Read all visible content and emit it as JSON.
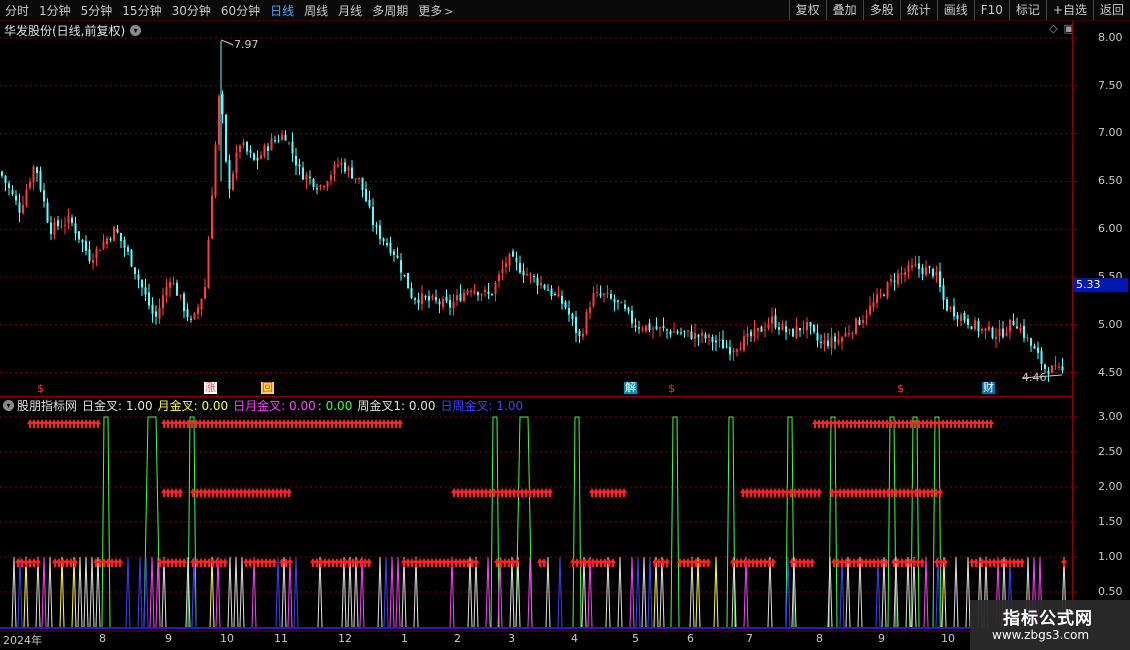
{
  "toolbar": {
    "periods": [
      "分时",
      "1分钟",
      "5分钟",
      "15分钟",
      "30分钟",
      "60分钟",
      "日线",
      "周线",
      "月线",
      "多周期",
      "更多"
    ],
    "active_period": "日线",
    "tools": [
      "复权",
      "叠加",
      "多股",
      "统计",
      "画线",
      "F10",
      "标记",
      "+自选",
      "返回"
    ]
  },
  "title": {
    "stock": "华发股份(日线,前复权)"
  },
  "price_axis": {
    "labels": [
      "8.00",
      "7.50",
      "7.00",
      "6.50",
      "6.00",
      "5.50",
      "5.00",
      "4.50"
    ],
    "current": "5.33"
  },
  "annotations": {
    "high": "7.97",
    "low": "4.46"
  },
  "signals": [
    {
      "text": "$",
      "color": "#ff3030"
    },
    {
      "text": "涨",
      "color": "#ff4040"
    },
    {
      "text": "回",
      "color": "#ffd060"
    },
    {
      "text": "解",
      "color": "#40c8ff"
    },
    {
      "text": "$",
      "color": "#ff3030"
    },
    {
      "text": "$",
      "color": "#ff3030"
    },
    {
      "text": "财",
      "color": "#40c8ff"
    }
  ],
  "indicator": {
    "name": "股朋指标网",
    "items": [
      {
        "label": "日金叉: 1.00",
        "color": "#e0e0e0"
      },
      {
        "label": "月金叉: 0.00",
        "color": "#ffff40"
      },
      {
        "label": "日月金叉: 0.00",
        "color": "#ff40ff"
      },
      {
        "label": ": 0.00",
        "color": "#40ff40"
      },
      {
        "label": "周金叉1: 0.00",
        "color": "#e0e0e0"
      },
      {
        "label": "日周金叉: 1.00",
        "color": "#4040ff"
      }
    ],
    "axis": [
      "3.00",
      "2.50",
      "2.00",
      "1.50",
      "1.00",
      "0.50"
    ]
  },
  "dates": [
    "2024年",
    "8",
    "9",
    "10",
    "11",
    "12",
    "1",
    "2",
    "3",
    "4",
    "5",
    "6",
    "7",
    "8",
    "9",
    "10"
  ],
  "watermark": {
    "title": "指标公式网",
    "url": "www.zbgs3.com"
  },
  "colors": {
    "up": "#ff3b3b",
    "down": "#54ffff",
    "grid": "#8b0000"
  }
}
